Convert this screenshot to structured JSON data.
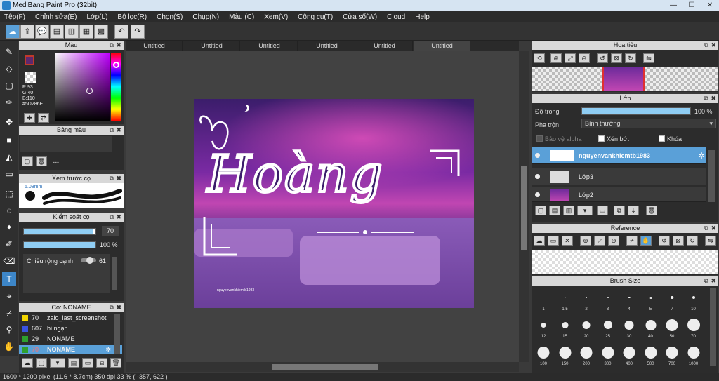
{
  "window": {
    "title": "MediBang Paint Pro (32bit)"
  },
  "menu": [
    "Tệp(F)",
    "Chỉnh sửa(E)",
    "Lớp(L)",
    "Bộ lọc(R)",
    "Chọn(S)",
    "Chụp(N)",
    "Màu (C)",
    "Xem(V)",
    "Công cụ(T)",
    "Cửa sổ(W)",
    "Cloud",
    "Help"
  ],
  "panels": {
    "color": {
      "title": "Màu",
      "r": "R:93",
      "g": "G:40",
      "b": "B:110",
      "hex": "#5D286E",
      "swatch": "#5d286e"
    },
    "palette": {
      "title": "Bảng màu",
      "value": "---"
    },
    "brush_preview": {
      "title": "Xem trước cọ",
      "size": "5.08mm"
    },
    "brush_control": {
      "title": "Kiểm soát cọ",
      "size_value": "70",
      "opacity_value": "100 %",
      "width_label": "Chiều rộng cạnh",
      "width_value": "61"
    },
    "brush_list": {
      "title": "Cọ: NONAME",
      "items": [
        {
          "num": "70",
          "name": "zalo_last_screenshot",
          "color": "#f2d600"
        },
        {
          "num": "607",
          "name": "bi ngạn",
          "color": "#3a53e0"
        },
        {
          "num": "29",
          "name": "NONAME",
          "color": "#2ea02e"
        },
        {
          "num": "70",
          "name": "NONAME",
          "color": "#2ea02e"
        }
      ]
    }
  },
  "tabs": [
    "Untitled",
    "Untitled",
    "Untitled",
    "Untitled",
    "Untitled",
    "Untitled"
  ],
  "artwork": {
    "main_text": "Hoàng",
    "watermark": "nguyenvankhiemtb1983"
  },
  "navigator": {
    "title": "Hoa tiêu"
  },
  "layers": {
    "title": "Lớp",
    "opacity_label": "Độ trong",
    "opacity_value": "100 %",
    "blend_label": "Pha trộn",
    "blend_value": "Bình thường",
    "protect_alpha": "Bảo vệ alpha",
    "clipping": "Xén bớt",
    "lock": "Khóa",
    "items": [
      {
        "name": "nguyenvankhiemtb1983"
      },
      {
        "name": "Lớp3"
      },
      {
        "name": "Lớp2"
      }
    ]
  },
  "reference": {
    "title": "Reference"
  },
  "brush_size": {
    "title": "Brush Size",
    "sizes": [
      "1",
      "1.5",
      "2",
      "3",
      "4",
      "5",
      "7",
      "10",
      "12",
      "15",
      "20",
      "25",
      "30",
      "40",
      "50",
      "70",
      "100",
      "150",
      "200",
      "300",
      "400",
      "500",
      "700",
      "1000"
    ]
  },
  "status": {
    "text": "1600 * 1200 pixel   (11.6 * 8.7cm)   350 dpi   33 %   ( -357, 622 )"
  },
  "colors": {
    "accent": "#5bbcf0",
    "selected_layer": "#5aa0d8"
  }
}
